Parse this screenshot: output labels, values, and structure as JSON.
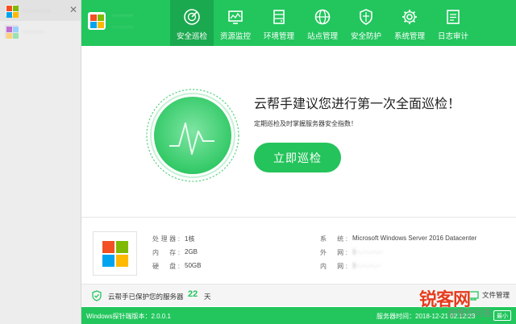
{
  "sidebar": {
    "servers": [
      {
        "name": "··········"
      },
      {
        "name": "········"
      }
    ]
  },
  "header": {
    "brand_title": "········",
    "brand_subtitle": "·········",
    "tabs": [
      {
        "label": "安全巡检",
        "icon": "scan-icon",
        "active": true
      },
      {
        "label": "资源监控",
        "icon": "monitor-icon"
      },
      {
        "label": "环境管理",
        "icon": "server-icon"
      },
      {
        "label": "站点管理",
        "icon": "globe-icon"
      },
      {
        "label": "安全防护",
        "icon": "shield-icon"
      },
      {
        "label": "系统管理",
        "icon": "gear-icon"
      },
      {
        "label": "日志审计",
        "icon": "document-icon"
      }
    ]
  },
  "main": {
    "headline": "云帮手建议您进行第一次全面巡检！",
    "subline": "定期巡检及时掌握服务器安全指数！",
    "scan_button": "立即巡检"
  },
  "info": {
    "cpu_label": "处理器:",
    "cpu_value": "1核",
    "mem_label": "内　存:",
    "mem_value": "2GB",
    "disk_label": "硬　盘:",
    "disk_value": "50GB",
    "os_label": "系　统:",
    "os_value": "Microsoft Windows Server 2016 Datacenter",
    "wan_label": "外　网:",
    "wan_value": "1··.···.···.··",
    "lan_label": "内　网:",
    "lan_value": "1··.··.···.··"
  },
  "status": {
    "protect_text": "云帮手已保护您的服务器",
    "days": "22",
    "days_unit": "天",
    "file_manager": "文件管理"
  },
  "footer": {
    "version": "Windows探针端版本：2.0.0.1",
    "server_time": "服务器时间：2018-12-21 02:12:23",
    "minimize": "最小"
  },
  "watermark": {
    "main": "锐客网",
    "sub": "@悟空问答"
  },
  "colors": {
    "brand_green": "#22c65d",
    "active_tab": "#1aa94e",
    "win_red": "#f25022",
    "win_green": "#7fba00",
    "win_blue": "#00a4ef",
    "win_yellow": "#ffb900"
  }
}
